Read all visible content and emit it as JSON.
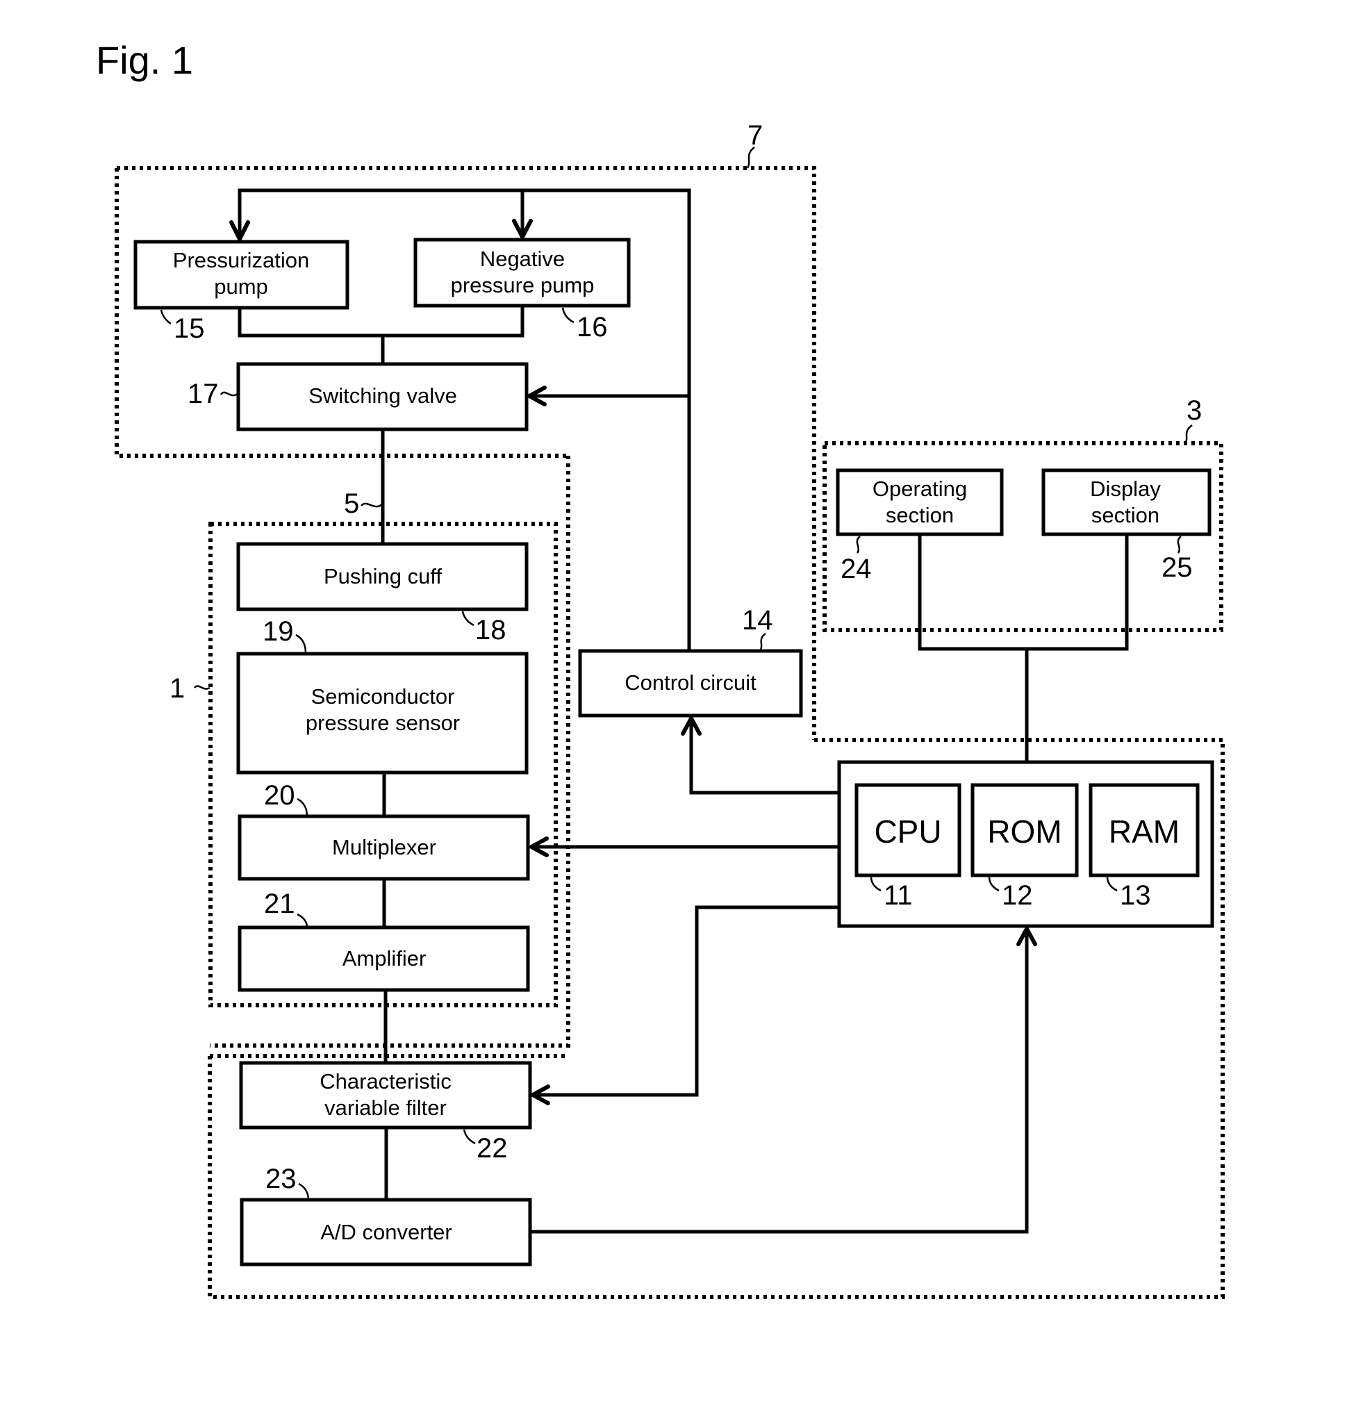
{
  "figure": {
    "title": "Fig. 1"
  },
  "groups": {
    "group_7": {
      "ref": "7"
    },
    "group_3": {
      "ref": "3"
    },
    "group_1": {
      "ref": "1"
    },
    "group_5": {
      "ref": "5"
    }
  },
  "blocks": {
    "pressurization_pump": {
      "lines": [
        "Pressurization",
        "pump"
      ],
      "ref": "15"
    },
    "negative_pressure_pump": {
      "lines": [
        "Negative",
        "pressure pump"
      ],
      "ref": "16"
    },
    "switching_valve": {
      "lines": [
        "Switching valve"
      ],
      "ref": "17"
    },
    "pushing_cuff": {
      "lines": [
        "Pushing cuff"
      ],
      "ref": "18"
    },
    "semiconductor_pressure_sensor": {
      "lines": [
        "Semiconductor",
        "pressure sensor"
      ],
      "ref": "19"
    },
    "multiplexer": {
      "lines": [
        "Multiplexer"
      ],
      "ref": "20"
    },
    "amplifier": {
      "lines": [
        "Amplifier"
      ],
      "ref": "21"
    },
    "characteristic_variable_filter": {
      "lines": [
        "Characteristic",
        "variable filter"
      ],
      "ref": "22"
    },
    "ad_converter": {
      "lines": [
        "A/D converter"
      ],
      "ref": "23"
    },
    "control_circuit": {
      "lines": [
        "Control circuit"
      ],
      "ref": "14"
    },
    "operating_section": {
      "lines": [
        "Operating",
        "section"
      ],
      "ref": "24"
    },
    "display_section": {
      "lines": [
        "Display",
        "section"
      ],
      "ref": "25"
    },
    "cpu": {
      "lines": [
        "CPU"
      ],
      "ref": "11"
    },
    "rom": {
      "lines": [
        "ROM"
      ],
      "ref": "12"
    },
    "ram": {
      "lines": [
        "RAM"
      ],
      "ref": "13"
    }
  },
  "connections": [
    {
      "from": "control_circuit",
      "to": "pressurization_pump",
      "arrow": true
    },
    {
      "from": "control_circuit",
      "to": "negative_pressure_pump",
      "arrow": true
    },
    {
      "from": "control_circuit",
      "to": "switching_valve",
      "arrow": true
    },
    {
      "from": "pressurization_pump",
      "to": "switching_valve",
      "arrow": false
    },
    {
      "from": "negative_pressure_pump",
      "to": "switching_valve",
      "arrow": false
    },
    {
      "from": "switching_valve",
      "to": "pushing_cuff",
      "arrow": false
    },
    {
      "from": "pushing_cuff",
      "to": "semiconductor_pressure_sensor",
      "arrow": false
    },
    {
      "from": "semiconductor_pressure_sensor",
      "to": "multiplexer",
      "arrow": false
    },
    {
      "from": "multiplexer",
      "to": "amplifier",
      "arrow": false
    },
    {
      "from": "amplifier",
      "to": "characteristic_variable_filter",
      "arrow": false
    },
    {
      "from": "characteristic_variable_filter",
      "to": "ad_converter",
      "arrow": false
    },
    {
      "from": "ad_converter",
      "to": "main_controller",
      "arrow": true
    },
    {
      "from": "main_controller",
      "to": "control_circuit",
      "arrow": true
    },
    {
      "from": "main_controller",
      "to": "multiplexer",
      "arrow": true
    },
    {
      "from": "main_controller",
      "to": "characteristic_variable_filter",
      "arrow": true
    },
    {
      "from": "operating_section",
      "to": "main_controller",
      "arrow": false
    },
    {
      "from": "display_section",
      "to": "main_controller",
      "arrow": false
    }
  ]
}
